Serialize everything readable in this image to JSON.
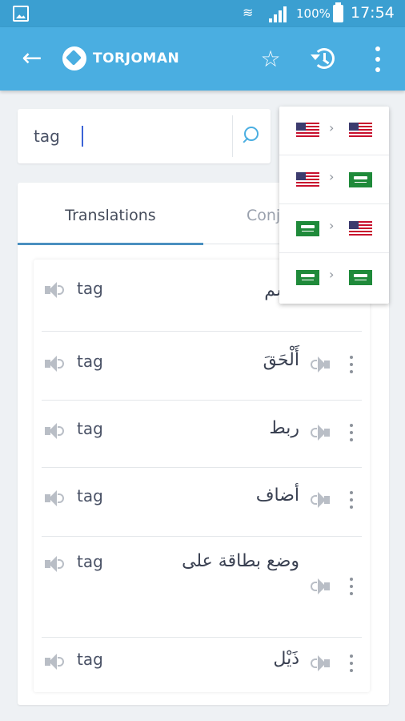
{
  "status_bar": {
    "battery": "100%",
    "time": "17:54"
  },
  "app_bar": {
    "title": "TORJOMAN"
  },
  "search": {
    "value": "tag"
  },
  "tabs": [
    {
      "label": "Translations",
      "active": true
    },
    {
      "label": "Conj",
      "active": false
    }
  ],
  "translations": [
    {
      "source": "tag",
      "target": "وسم"
    },
    {
      "source": "tag",
      "target": "أَلْحَقَ"
    },
    {
      "source": "tag",
      "target": "ربط"
    },
    {
      "source": "tag",
      "target": "أضاف"
    },
    {
      "source": "tag",
      "target": "وضع بطاقة على"
    },
    {
      "source": "tag",
      "target": "ذَيْل"
    }
  ],
  "language_pairs": [
    {
      "from": "en-us-flag",
      "to": "en-us-flag"
    },
    {
      "from": "en-us-flag",
      "to": "sa-flag"
    },
    {
      "from": "sa-flag",
      "to": "en-us-flag"
    },
    {
      "from": "sa-flag",
      "to": "sa-flag"
    }
  ],
  "colors": {
    "app_bar": "#4aaee1",
    "status_bar": "#3b9fd1",
    "tab_indicator": "#4a90c0"
  }
}
